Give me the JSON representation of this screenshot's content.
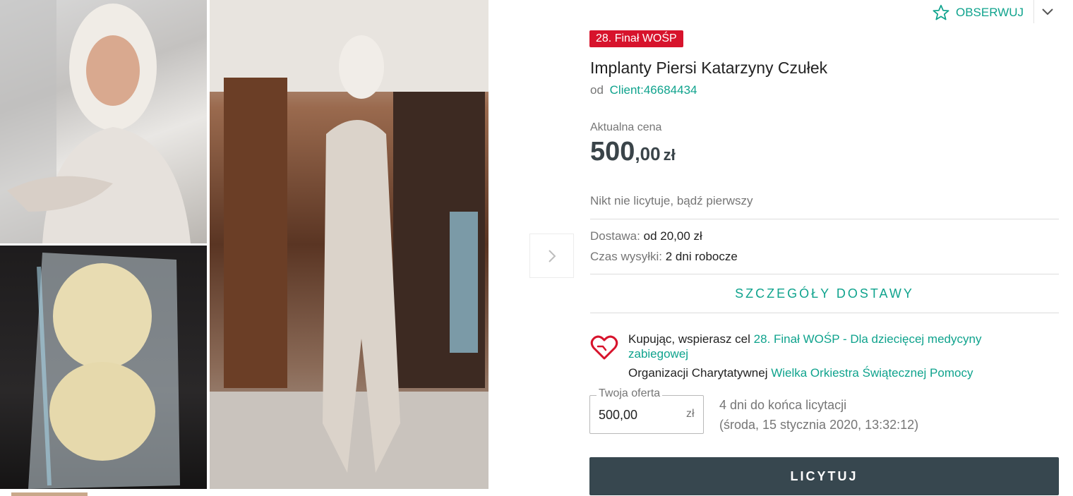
{
  "gallery": {
    "images": [
      "portrait-photo",
      "implants-package-photo",
      "full-length-photo"
    ]
  },
  "watch": {
    "label": "OBSERWUJ",
    "icon": "star-outline-icon"
  },
  "offer": {
    "badge": "28. Finał WOŚP",
    "title": "Implanty Piersi Katarzyny Czułek",
    "seller_prefix": "od",
    "seller_name": "Client:46684434"
  },
  "price": {
    "label": "Aktualna cena",
    "integer": "500",
    "decimal": ",00",
    "currency": "zł"
  },
  "bids": {
    "status": "Nikt nie licytuje, bądź pierwszy"
  },
  "delivery": {
    "cost_label": "Dostawa:",
    "cost_value": "od 20,00 zł",
    "dispatch_label": "Czas wysyłki:",
    "dispatch_value": "2 dni robocze",
    "details_link": "SZCZEGÓŁY DOSTAWY"
  },
  "charity": {
    "text_prefix": "Kupując, wspierasz cel",
    "goal_link": "28. Finał WOŚP - Dla dziecięcej medycyny zabiegowej",
    "org_prefix": "Organizacji Charytatywnej",
    "org_link": "Wielka Orkiestra Świątecznej Pomocy"
  },
  "bid_form": {
    "legend": "Twoja oferta",
    "value": "500,00",
    "currency": "zł",
    "ends_in": "4 dni do końca licytacji",
    "ends_at": "(środa, 15 stycznia 2020, 13:32:12)",
    "submit_label": "LICYTUJ"
  },
  "colors": {
    "accent": "#0fa38d",
    "badge": "#d7132c",
    "button": "#37474f",
    "heart": "#d7132c"
  }
}
